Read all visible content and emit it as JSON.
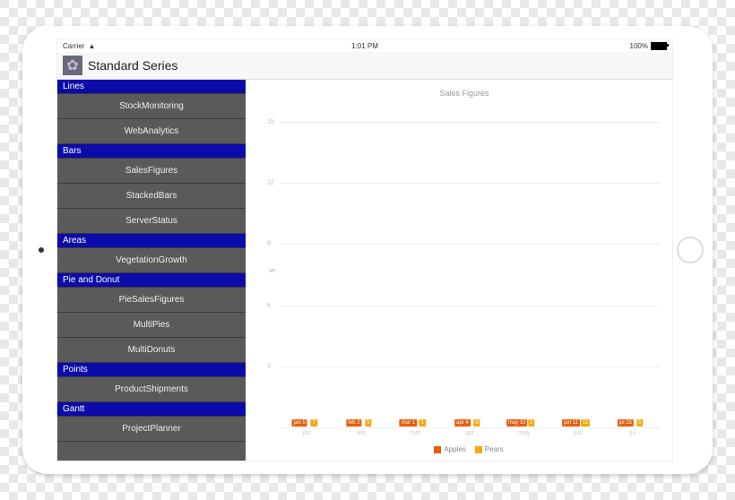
{
  "statusbar": {
    "carrier": "Carrier",
    "time": "1:01 PM",
    "battery": "100%"
  },
  "header": {
    "title": "Standard Series"
  },
  "sidebar": {
    "sections": [
      {
        "title": "Lines",
        "items": [
          "StockMonitoring",
          "WebAnalytics"
        ]
      },
      {
        "title": "Bars",
        "items": [
          "SalesFigures",
          "StackedBars",
          "ServerStatus"
        ]
      },
      {
        "title": "Areas",
        "items": [
          "VegetationGrowth"
        ]
      },
      {
        "title": "Pie and Donut",
        "items": [
          "PieSalesFigures",
          "MultiPies",
          "MultiDonuts"
        ]
      },
      {
        "title": "Points",
        "items": [
          "ProductShipments"
        ]
      },
      {
        "title": "Gantt",
        "items": [
          "ProjectPlanner"
        ]
      }
    ]
  },
  "chart_data": {
    "type": "bar",
    "title": "Sales Figures",
    "ylabel": "$",
    "xlabel": "",
    "categories": [
      "jan",
      "feb",
      "mar",
      "apr",
      "may",
      "jun",
      "jul"
    ],
    "series": [
      {
        "name": "Apples",
        "color": "#e85d0b",
        "values": [
          5,
          2,
          1,
          4,
          10,
          11,
          15
        ]
      },
      {
        "name": "Pears",
        "color": "#f6a80b",
        "values": [
          7,
          5,
          1,
          6,
          2,
          11,
          5
        ]
      }
    ],
    "ylim": [
      0,
      16
    ],
    "yticks": [
      3,
      6,
      9,
      12,
      15
    ],
    "datalabels": {
      "apples": [
        "jan 5",
        "feb 2",
        "mar 1",
        "apr 4",
        "may 10",
        "jun 11",
        "jul 15"
      ],
      "pears": [
        "7",
        "5",
        "1",
        "6",
        "2",
        "11",
        "5"
      ]
    },
    "legend_position": "bottom"
  }
}
